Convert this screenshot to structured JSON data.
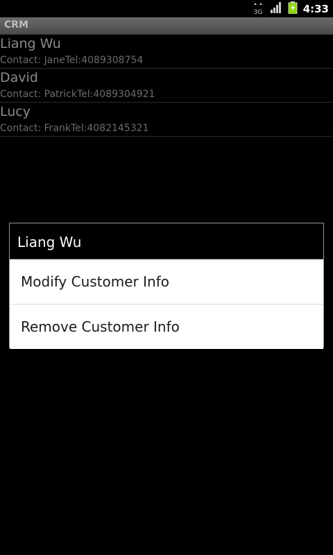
{
  "status_bar": {
    "network_label": "3G",
    "time": "4:33",
    "icons": [
      "data-arrows-icon",
      "signal-icon",
      "battery-charging-icon"
    ],
    "battery_color": "#8bd400"
  },
  "app": {
    "title": "CRM"
  },
  "customers": [
    {
      "name": "Liang Wu",
      "contact": "Contact: JaneTel:4089308754"
    },
    {
      "name": "David",
      "contact": "Contact: PatrickTel:4089304921"
    },
    {
      "name": "Lucy",
      "contact": "Contact: FrankTel:4082145321"
    }
  ],
  "dialog": {
    "title": "Liang Wu",
    "options": [
      {
        "label": "Modify Customer Info"
      },
      {
        "label": "Remove Customer Info"
      }
    ]
  }
}
